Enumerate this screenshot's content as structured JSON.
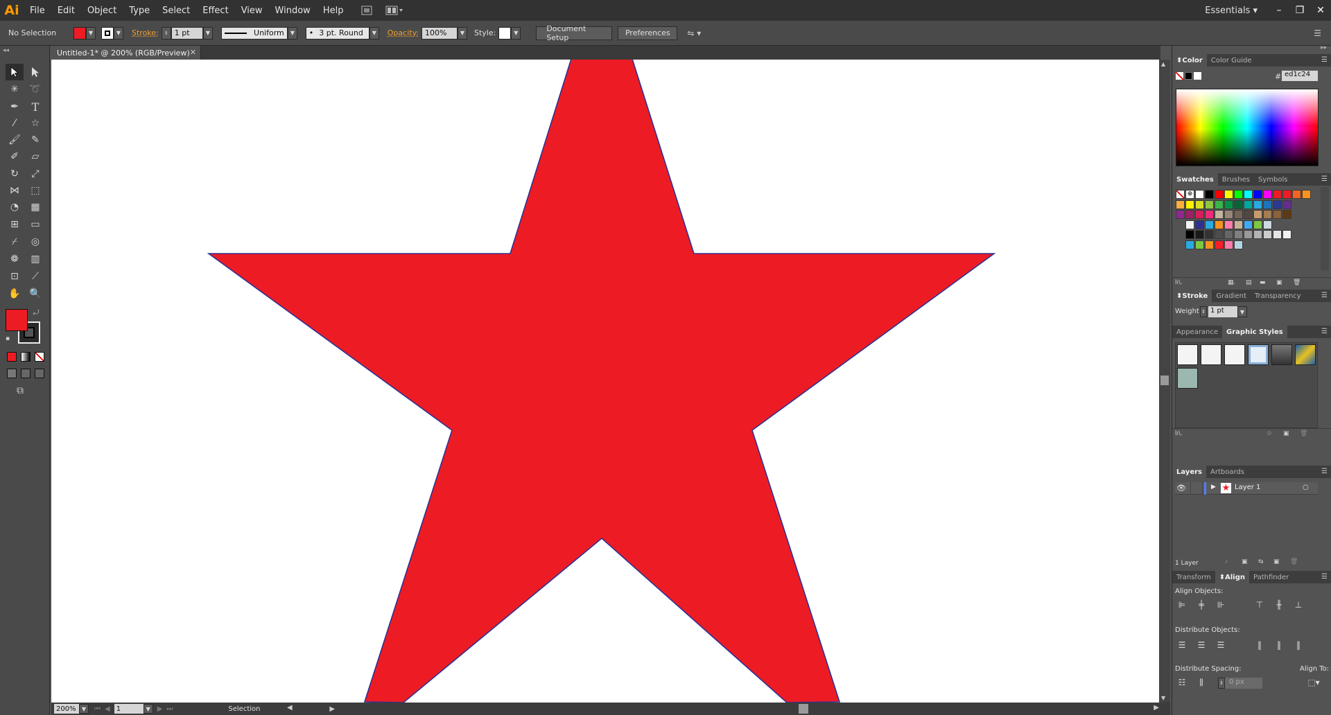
{
  "app": {
    "logo": "Ai",
    "menu": [
      "File",
      "Edit",
      "Object",
      "Type",
      "Select",
      "Effect",
      "View",
      "Window",
      "Help"
    ],
    "workspace": "Essentials"
  },
  "control": {
    "selection": "No Selection",
    "fill_color": "#ed1c24",
    "stroke_label": "Stroke:",
    "stroke_weight": "1 pt",
    "profile": "Uniform",
    "brush": "3 pt. Round",
    "opacity_label": "Opacity:",
    "opacity": "100%",
    "style_label": "Style:",
    "doc_setup": "Document Setup",
    "preferences": "Preferences"
  },
  "document": {
    "tab_title": "Untitled-1* @ 200% (RGB/Preview)",
    "zoom": "200%",
    "artboard": "1",
    "status": "Selection"
  },
  "artwork": {
    "fill": "#ed1c24",
    "stroke": "#2e3192"
  },
  "panels": {
    "color": {
      "tabs": [
        "Color",
        "Color Guide"
      ],
      "hex": "ed1c24"
    },
    "swatches": {
      "tabs": [
        "Swatches",
        "Brushes",
        "Symbols"
      ]
    },
    "stroke": {
      "tabs": [
        "Stroke",
        "Gradient",
        "Transparency"
      ],
      "weight_label": "Weight:",
      "weight": "1 pt"
    },
    "graphic_styles": {
      "tabs": [
        "Appearance",
        "Graphic Styles"
      ]
    },
    "layers": {
      "tabs": [
        "Layers",
        "Artboards"
      ],
      "layer_name": "Layer 1",
      "count": "1 Layer"
    },
    "align": {
      "tabs": [
        "Transform",
        "Align",
        "Pathfinder"
      ],
      "align_objects": "Align Objects:",
      "distribute_objects": "Distribute Objects:",
      "distribute_spacing": "Distribute Spacing:",
      "align_to": "Align To:",
      "spacing_value": "0 px"
    }
  },
  "swatch_colors": {
    "row1": [
      "#ffffff",
      "#000000",
      "#ff0000",
      "#ffff00",
      "#00ff00",
      "#00ffff",
      "#0000ff",
      "#ff00ff",
      "#ed1c24",
      "#ed1c24",
      "#f26522",
      "#f7941d"
    ],
    "row2": [
      "#fbaf3f",
      "#fff200",
      "#d7df23",
      "#8dc63f",
      "#39b54a",
      "#009444",
      "#006838",
      "#00a79d",
      "#27aae1",
      "#1c75bc",
      "#2b3990",
      "#662d91"
    ],
    "row3": [
      "#92278f",
      "#9e1f63",
      "#da1c5c",
      "#ee2a7b",
      "#c2b59b",
      "#998675",
      "#736357",
      "#534741",
      "#c69c6d",
      "#a67c52",
      "#8c6239",
      "#603913"
    ],
    "row4": [
      "#f1f2f2",
      "#2e3192",
      "#29abe2",
      "#f7931e",
      "#ff7bac",
      "#c7b299",
      "#3fa9f5",
      "#7ac943",
      "#ccd9e0"
    ],
    "row5": [
      "#000000",
      "#1a1a1a",
      "#333333",
      "#4d4d4d",
      "#666666",
      "#808080",
      "#999999",
      "#b3b3b3",
      "#cccccc",
      "#e6e6e6",
      "#f2f2f2"
    ],
    "row6": [
      "#29abe2",
      "#7ac943",
      "#f7931e",
      "#ff1d25",
      "#ff7bac",
      "#b3d4e0"
    ]
  }
}
